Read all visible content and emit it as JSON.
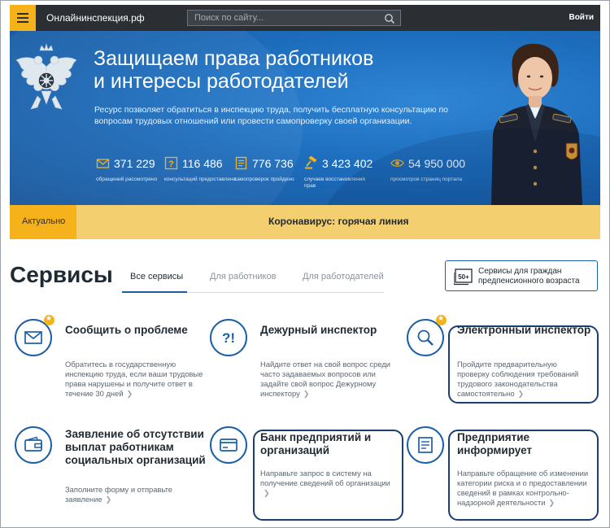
{
  "topbar": {
    "site_name": "Онлайнинспекция.рф",
    "search_placeholder": "Поиск по сайту...",
    "login_label": "Войти"
  },
  "hero": {
    "title_line1": "Защищаем права работников",
    "title_line2": "и интересы работодателей",
    "description": "Ресурс позволяет обратиться в инспекцию труда, получить бесплатную консультацию по вопросам трудовых отношений или провести самопроверку своей организации.",
    "stats": [
      {
        "icon": "envelope-icon",
        "value": "371 229",
        "caption": "обращений рассмотрено"
      },
      {
        "icon": "question-icon",
        "value": "116 486",
        "caption": "консультаций предоставлено"
      },
      {
        "icon": "checklist-icon",
        "value": "776 736",
        "caption": "самопроверок пройдено"
      },
      {
        "icon": "gavel-icon",
        "value": "3 423 402",
        "caption": "случаев восстановления прав"
      },
      {
        "icon": "eye-icon",
        "value": "54 950 000",
        "caption": "просмотров страниц портала"
      }
    ]
  },
  "banner": {
    "tag": "Актуально",
    "text": "Коронавирус: горячая линия"
  },
  "services": {
    "title": "Сервисы",
    "tabs": [
      "Все сервисы",
      "Для работников",
      "Для работодателей"
    ],
    "active_tab": "Все сервисы",
    "seniors_button": "Сервисы для граждан предпенсионного возраста",
    "seniors_badge": "50+",
    "cards": [
      {
        "icon": "envelope-icon",
        "title": "Сообщить о проблеме",
        "description": "Обратитесь в государственную инспекцию труда, если ваши трудовые права нарушены и получите ответ в течение 30 дней",
        "starred": true
      },
      {
        "icon": "question-icon",
        "title": "Дежурный инспектор",
        "description": "Найдите ответ на свой вопрос среди часто задаваемых вопросов или задайте свой вопрос Дежурному инспектору",
        "starred": false
      },
      {
        "icon": "magnifier-icon",
        "title": "Электронный инспектор",
        "description": "Пройдите предварительную проверку соблюдения требований трудового законодательства самостоятельно",
        "starred": true
      },
      {
        "icon": "wallet-icon",
        "title": "Заявление об отсутствии выплат работникам социальных организаций",
        "description": "Заполните форму и отправьте заявление",
        "starred": false
      },
      {
        "icon": "bank-card-icon",
        "title": "Банк предприятий и организаций",
        "description": "Направьте запрос в систему на получение сведений об организации",
        "starred": false
      },
      {
        "icon": "document-icon",
        "title": "Предприятие информирует",
        "description": "Направьте обращение об изменении категории риска и о предоставлении сведений в рамках контрольно-надзорной деятельности",
        "starred": false
      }
    ]
  },
  "colors": {
    "topbar": "#2b2f33",
    "accent": "#f6b21b",
    "hero_blue": "#1d6dbd",
    "banner": "#f4cf6f",
    "link_blue": "#1a5fa8",
    "highlight_border": "#1a3f6e"
  }
}
